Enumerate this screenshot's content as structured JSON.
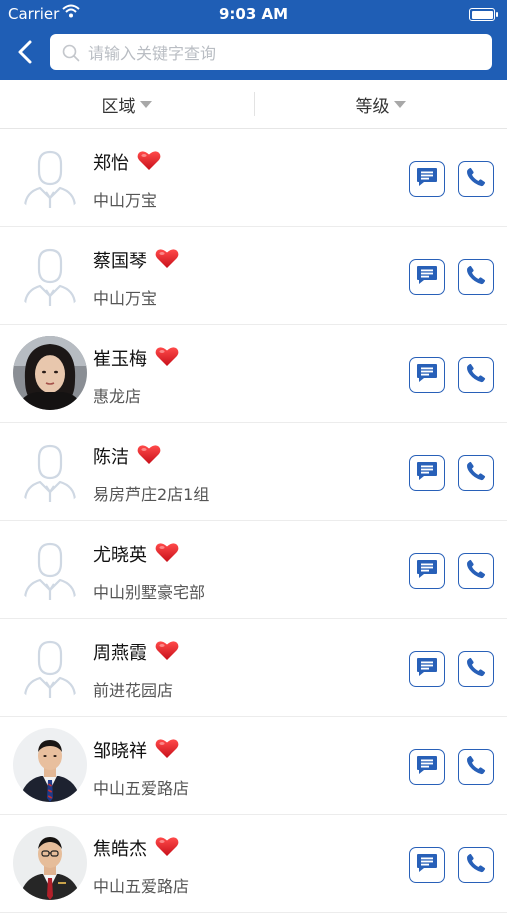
{
  "status_bar": {
    "carrier": "Carrier",
    "time": "9:03 AM"
  },
  "header": {
    "search_placeholder": "请输入关键字查询"
  },
  "filters": [
    {
      "label": "区域"
    },
    {
      "label": "等级"
    }
  ],
  "colors": {
    "primary": "#1f5eb5",
    "heart": "#e0151f",
    "button_border": "#2860b8"
  },
  "agents": [
    {
      "name": "郑怡",
      "store": "中山万宝",
      "avatar": "placeholder",
      "favorite": true
    },
    {
      "name": "蔡国琴",
      "store": "中山万宝",
      "avatar": "placeholder",
      "favorite": true
    },
    {
      "name": "崔玉梅",
      "store": "惠龙店",
      "avatar": "photo-woman",
      "favorite": true
    },
    {
      "name": "陈洁",
      "store": "易房芦庄2店1组",
      "avatar": "placeholder",
      "favorite": true
    },
    {
      "name": "尤晓英",
      "store": "中山别墅豪宅部",
      "avatar": "placeholder",
      "favorite": true
    },
    {
      "name": "周燕霞",
      "store": "前进花园店",
      "avatar": "placeholder",
      "favorite": true
    },
    {
      "name": "邹晓祥",
      "store": "中山五爱路店",
      "avatar": "photo-man-1",
      "favorite": true
    },
    {
      "name": "焦皓杰",
      "store": "中山五爱路店",
      "avatar": "photo-man-2",
      "favorite": true
    }
  ],
  "icons": {
    "back": "chevron-left-icon",
    "search": "search-icon",
    "favorite": "heart-icon",
    "message": "message-icon",
    "call": "phone-icon"
  }
}
